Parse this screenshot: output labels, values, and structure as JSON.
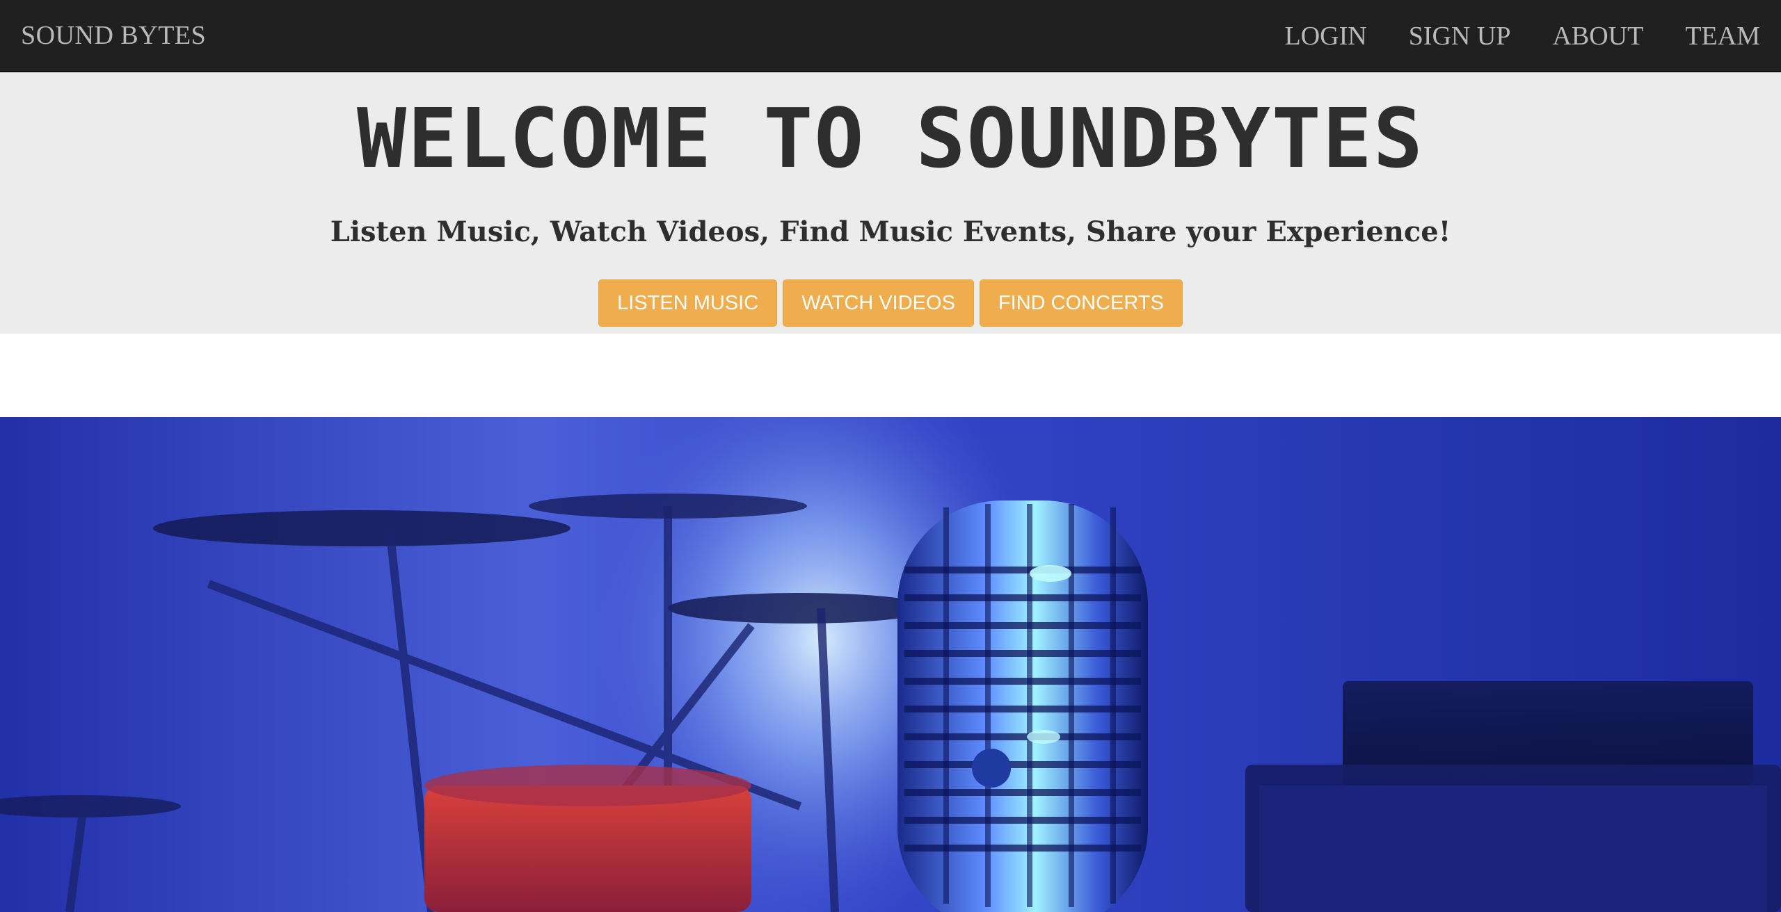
{
  "navbar": {
    "brand": "SOUND BYTES",
    "links": [
      "LOGIN",
      "SIGN UP",
      "ABOUT",
      "TEAM"
    ]
  },
  "hero": {
    "title": "WELCOME TO SOUNDBYTES",
    "subtitle": "Listen Music, Watch Videos, Find Music Events, Share your Experience!",
    "buttons": [
      "LISTEN MUSIC",
      "WATCH VIDEOS",
      "FIND CONCERTS"
    ]
  },
  "colors": {
    "navbar_bg": "#202020",
    "hero_bg": "#ececec",
    "button_bg": "#f0ad4e",
    "photo_blue": "#2a3dc4"
  },
  "icons": {
    "banner": "microphone-drumkit-photo"
  }
}
